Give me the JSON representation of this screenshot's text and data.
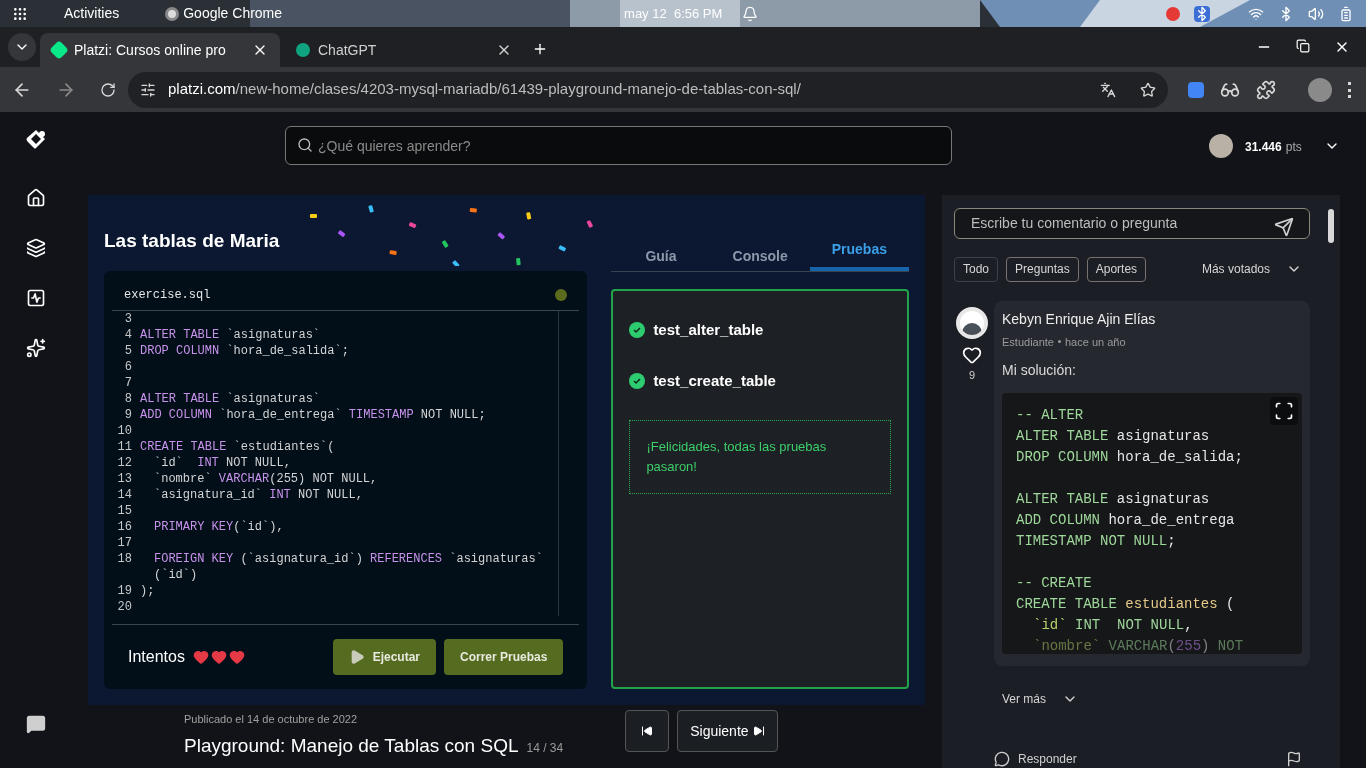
{
  "os_bar": {
    "activities": "Activities",
    "app": "Google Chrome",
    "clock": "may 12  6:56 PM"
  },
  "browser": {
    "tabs": [
      {
        "title": "Platzi: Cursos online pro",
        "selected": true
      },
      {
        "title": "ChatGPT",
        "selected": false
      }
    ],
    "url_host": "platzi.com",
    "url_path": "/new-home/clases/4203-mysql-mariadb/61439-playground-manejo-de-tablas-con-sql/"
  },
  "header": {
    "search_placeholder": "¿Qué quieres aprender?",
    "points": "31.446",
    "points_unit": "pts"
  },
  "lesson": {
    "title": "Las tablas de Maria",
    "editor": {
      "filename": "exercise.sql",
      "lines": [
        {
          "number": "3",
          "kind": "blank"
        },
        {
          "number": "4",
          "kind": "code",
          "indented": false,
          "segments": [
            {
              "kind": "keyword",
              "text": "ALTER TABLE"
            },
            {
              "kind": "plain",
              "text": " `asignaturas`"
            }
          ]
        },
        {
          "number": "5",
          "kind": "code",
          "indented": false,
          "segments": [
            {
              "kind": "keyword",
              "text": "DROP COLUMN"
            },
            {
              "kind": "plain",
              "text": " `hora_de_salida`;"
            }
          ]
        },
        {
          "number": "6",
          "kind": "blank"
        },
        {
          "number": "7",
          "kind": "blank"
        },
        {
          "number": "8",
          "kind": "code",
          "indented": false,
          "segments": [
            {
              "kind": "keyword",
              "text": "ALTER TABLE"
            },
            {
              "kind": "plain",
              "text": " `asignaturas`"
            }
          ]
        },
        {
          "number": "9",
          "kind": "code",
          "indented": false,
          "segments": [
            {
              "kind": "keyword",
              "text": "ADD COLUMN"
            },
            {
              "kind": "plain",
              "text": " `hora_de_entrega` "
            },
            {
              "kind": "keyword",
              "text": "TIMESTAMP"
            },
            {
              "kind": "plain",
              "text": " NOT NULL;"
            }
          ]
        },
        {
          "number": "10",
          "kind": "blank"
        },
        {
          "number": "11",
          "kind": "code",
          "indented": false,
          "segments": [
            {
              "kind": "keyword",
              "text": "CREATE TABLE"
            },
            {
              "kind": "plain",
              "text": " `estudiantes`("
            }
          ]
        },
        {
          "number": "12",
          "kind": "code",
          "indented": true,
          "segments": [
            {
              "kind": "plain",
              "text": "`id`  "
            },
            {
              "kind": "keyword",
              "text": "INT"
            },
            {
              "kind": "plain",
              "text": " NOT NULL,"
            }
          ]
        },
        {
          "number": "13",
          "kind": "code",
          "indented": true,
          "segments": [
            {
              "kind": "plain",
              "text": "`nombre` "
            },
            {
              "kind": "keyword",
              "text": "VARCHAR"
            },
            {
              "kind": "plain",
              "text": "(255) NOT NULL,"
            }
          ]
        },
        {
          "number": "14",
          "kind": "code",
          "indented": true,
          "segments": [
            {
              "kind": "plain",
              "text": "`asignatura_id` "
            },
            {
              "kind": "keyword",
              "text": "INT"
            },
            {
              "kind": "plain",
              "text": " NOT NULL,"
            }
          ]
        },
        {
          "number": "15",
          "kind": "blank"
        },
        {
          "number": "16",
          "kind": "code",
          "indented": true,
          "segments": [
            {
              "kind": "keyword",
              "text": "PRIMARY KEY"
            },
            {
              "kind": "plain",
              "text": "(`id`),"
            }
          ]
        },
        {
          "number": "17",
          "kind": "blank"
        },
        {
          "number": "18",
          "kind": "code",
          "indented": true,
          "segments": [
            {
              "kind": "keyword",
              "text": "FOREIGN KEY"
            },
            {
              "kind": "plain",
              "text": " (`asignatura_id`) "
            },
            {
              "kind": "keyword",
              "text": "REFERENCES"
            },
            {
              "kind": "plain",
              "text": " `asignaturas` (`id`)"
            }
          ]
        },
        {
          "number": "19",
          "kind": "code",
          "indented": false,
          "segments": [
            {
              "kind": "plain",
              "text": ");"
            }
          ]
        },
        {
          "number": "20",
          "kind": "blank"
        }
      ]
    },
    "attempts_label": "Intentos",
    "hearts": [
      {
        "filled": true
      },
      {
        "filled": true
      },
      {
        "filled": true
      }
    ],
    "buttons": [
      {
        "kind": "run",
        "label": "Ejecutar"
      },
      {
        "kind": "test",
        "label": "Correr Pruebas"
      }
    ],
    "tabs": [
      {
        "label": "Guía",
        "selected": false
      },
      {
        "label": "Console",
        "selected": false
      },
      {
        "label": "Pruebas",
        "selected": true
      }
    ],
    "tests": [
      {
        "name": "test_alter_table",
        "passed": true
      },
      {
        "name": "test_create_table",
        "passed": true
      }
    ],
    "success_message": "¡Felicidades, todas las pruebas pasaron!",
    "published": "Publicado el 14 de octubre de 2022",
    "class_title": "Playground: Manejo de Tablas con SQL",
    "counter": "14 / 34",
    "next_label": "Siguiente"
  },
  "comments": {
    "input_placeholder": "Escribe tu comentario o pregunta",
    "filters": [
      "Todo",
      "Preguntas",
      "Aportes"
    ],
    "sort": "Más votados",
    "items": [
      {
        "author": "Kebyn Enrique Ajin Elías",
        "role": "Estudiante",
        "time": "hace un año",
        "likes": "9",
        "text": "Mi solución:",
        "code": [
          {
            "kind": "code",
            "indented": false,
            "segments": [
              {
                "kind": "comment",
                "text": "-- ALTER"
              }
            ]
          },
          {
            "kind": "code",
            "indented": false,
            "segments": [
              {
                "kind": "keyword",
                "text": "ALTER TABLE"
              },
              {
                "kind": "plain",
                "text": " asignaturas"
              }
            ]
          },
          {
            "kind": "code",
            "indented": false,
            "segments": [
              {
                "kind": "keyword",
                "text": "DROP COLUMN"
              },
              {
                "kind": "plain",
                "text": " hora_de_salida;"
              }
            ]
          },
          {
            "kind": "blank"
          },
          {
            "kind": "code",
            "indented": false,
            "segments": [
              {
                "kind": "keyword",
                "text": "ALTER TABLE"
              },
              {
                "kind": "plain",
                "text": " asignaturas"
              }
            ]
          },
          {
            "kind": "code",
            "indented": false,
            "segments": [
              {
                "kind": "keyword",
                "text": "ADD COLUMN"
              },
              {
                "kind": "plain",
                "text": " hora_de_entrega"
              }
            ]
          },
          {
            "kind": "code",
            "indented": false,
            "segments": [
              {
                "kind": "keyword",
                "text": "TIMESTAMP NOT NULL"
              },
              {
                "kind": "plain",
                "text": ";"
              }
            ]
          },
          {
            "kind": "blank"
          },
          {
            "kind": "code",
            "indented": false,
            "segments": [
              {
                "kind": "comment",
                "text": "-- CREATE"
              }
            ]
          },
          {
            "kind": "code",
            "indented": false,
            "segments": [
              {
                "kind": "keyword",
                "text": "CREATE TABLE"
              },
              {
                "kind": "table",
                "text": " estudiantes"
              },
              {
                "kind": "plain",
                "text": " ("
              }
            ]
          },
          {
            "kind": "code",
            "indented": true,
            "segments": [
              {
                "kind": "string",
                "text": "`id`"
              },
              {
                "kind": "keyword",
                "text": " INT  NOT NULL"
              },
              {
                "kind": "plain",
                "text": ","
              }
            ]
          },
          {
            "kind": "code",
            "indented": true,
            "segments": [
              {
                "kind": "string",
                "text": "`nombre`"
              },
              {
                "kind": "keyword",
                "text": " VARCHAR"
              },
              {
                "kind": "plain",
                "text": "("
              },
              {
                "kind": "number",
                "text": "255"
              },
              {
                "kind": "plain",
                "text": ")"
              },
              {
                "kind": "keyword",
                "text": " NOT"
              }
            ]
          }
        ],
        "more": "Ver más",
        "reply": "Responder"
      }
    ]
  }
}
